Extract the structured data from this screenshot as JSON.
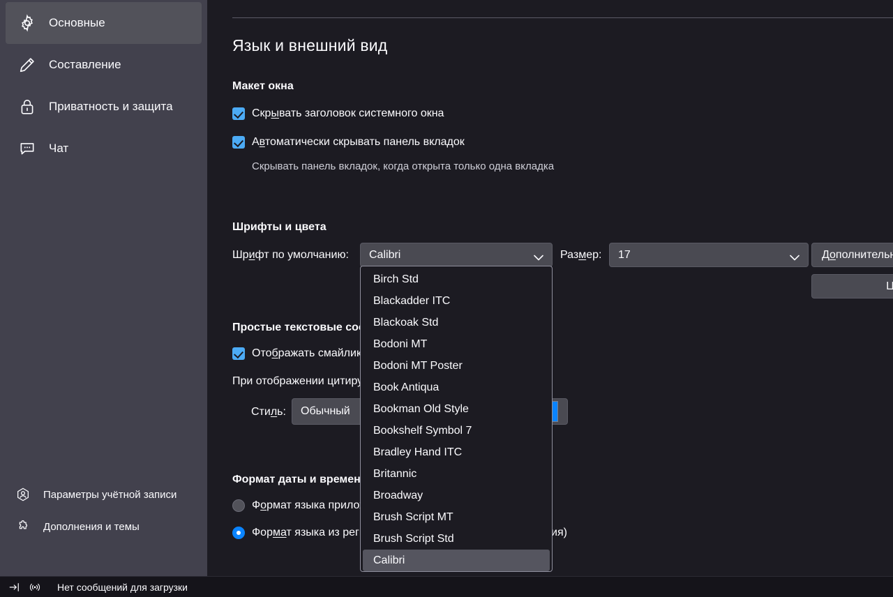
{
  "sidebar": {
    "items": [
      {
        "label": "Основные",
        "icon": "gear-icon",
        "selected": true
      },
      {
        "label": "Составление",
        "icon": "pencil-icon",
        "selected": false
      },
      {
        "label": "Приватность и защита",
        "icon": "lock-icon",
        "selected": false
      },
      {
        "label": "Чат",
        "icon": "chat-bubble-icon",
        "selected": false
      }
    ],
    "bottom_items": [
      {
        "label": "Параметры учётной записи",
        "icon": "account-icon"
      },
      {
        "label": "Дополнения и темы",
        "icon": "puzzle-piece-icon"
      }
    ]
  },
  "statusbar": {
    "collapse_icon": "collapse-panel-icon",
    "activity_icon": "connection-activity-icon",
    "message": "Нет сообщений для загрузки"
  },
  "main": {
    "page_title": "Язык и внешний вид",
    "window_layout": {
      "heading": "Макет окна",
      "checkbox_hide_titlebar": {
        "label": "Скрывать заголовок системного окна",
        "mnemonic": "ы",
        "checked": true
      },
      "checkbox_autohide_tabbar": {
        "label": "Автоматически скрывать панель вкладок",
        "mnemonic": "в",
        "checked": true
      },
      "autohide_note": "Скрывать панель вкладок, когда открыта только одна вкладка"
    },
    "fonts_colors": {
      "heading": "Шрифты и цвета",
      "default_font_label": "Шрифт по умолчанию:",
      "default_font_mnemonic": "и",
      "default_font_value": "Calibri",
      "size_label": "Размер:",
      "size_mnemonic": "м",
      "size_value": "17",
      "advanced_button": "Дополнительно...",
      "advanced_mnemonic": "о",
      "colors_button": "Цвета...",
      "colors_mnemonic": "а",
      "swatch_color": "#0a84ff"
    },
    "plaintext": {
      "heading": "Простые текстовые сообщения",
      "checkbox_emoji": {
        "label": "Отображать смайлики как рисунки",
        "mnemonic": "б",
        "checked": true
      },
      "quote_label": "При отображении цитируемого текста:",
      "style_label": "Стиль:",
      "style_mnemonic": "л",
      "style_value": "Обычный"
    },
    "datetime": {
      "heading": "Формат даты и времени",
      "radio_app_language": {
        "label": "Формат языка приложения",
        "mnemonic": "о",
        "selected": false
      },
      "radio_regional_language": {
        "label": "Формат языка из региональных настроек",
        "mnemonic": "ма",
        "selected": true
      },
      "regional_suffix_visible": "сия)"
    }
  },
  "font_dropdown": {
    "options": [
      "Birch Std",
      "Blackadder ITC",
      "Blackoak Std",
      "Bodoni MT",
      "Bodoni MT Poster",
      "Book Antiqua",
      "Bookman Old Style",
      "Bookshelf Symbol 7",
      "Bradley Hand ITC",
      "Britannic",
      "Broadway",
      "Brush Script MT",
      "Brush Script Std",
      "Calibri"
    ],
    "selected": "Calibri"
  },
  "colors": {
    "sidebar_bg": "#42414d",
    "sidebar_selected": "#52525a",
    "main_bg": "#1c1b22",
    "control_bg": "#4a4a52",
    "accent": "#4cabf5",
    "radio_accent": "#0a84ff",
    "statusbar_bg": "#15141a",
    "text": "#fbfbfe"
  }
}
